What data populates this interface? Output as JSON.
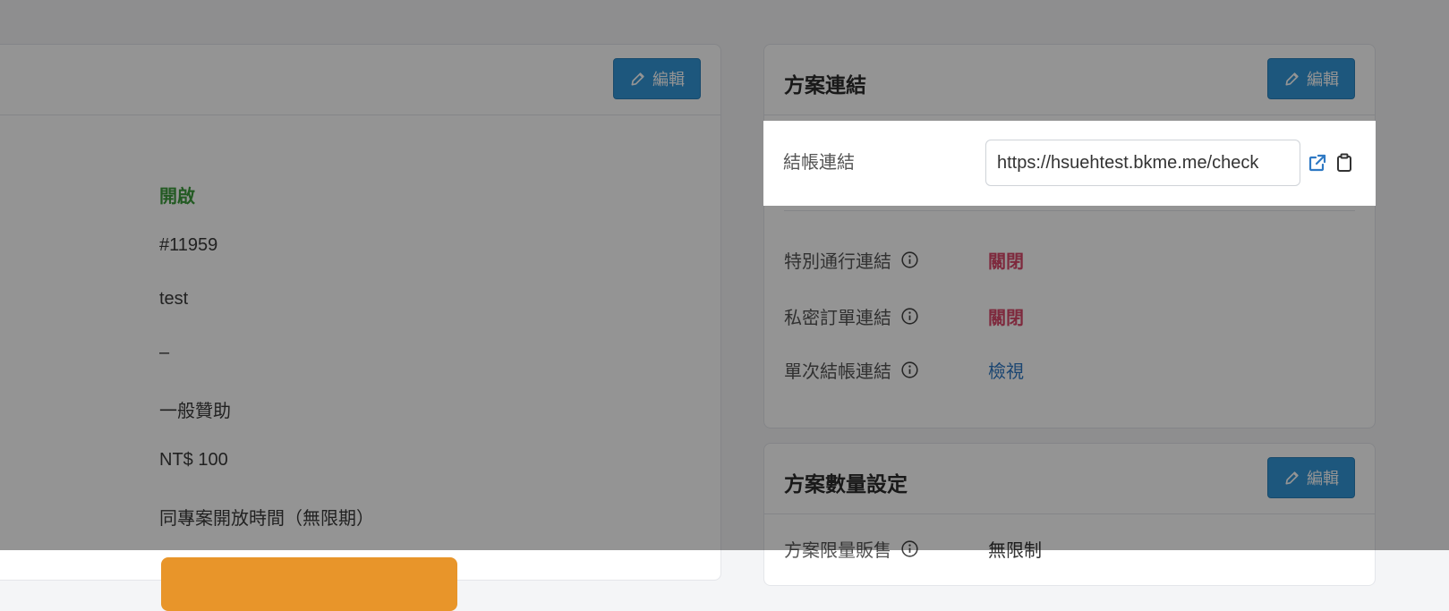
{
  "left_card": {
    "edit_label": "編輯",
    "values": {
      "status": "開啟",
      "id": "#11959",
      "name": "test",
      "dash": "–",
      "type": "一般贊助",
      "price": "NT$ 100",
      "period": "同專案開放時間（無限期）"
    }
  },
  "link_card": {
    "title": "方案連結",
    "edit_label": "編輯",
    "checkout": {
      "label": "結帳連結",
      "url": "https://hsuehtest.bkme.me/check"
    },
    "special": {
      "label": "特別通行連結",
      "value": "關閉"
    },
    "private": {
      "label": "私密訂單連結",
      "value": "關閉"
    },
    "single": {
      "label": "單次結帳連結",
      "value": "檢視"
    }
  },
  "qty_card": {
    "title": "方案數量設定",
    "edit_label": "編輯",
    "limit": {
      "label": "方案限量販售",
      "value": "無限制"
    }
  },
  "colors": {
    "accent": "#3296d8",
    "enabled": "#3c9b3c",
    "disabled": "#d9486a",
    "link": "#2f79c4"
  }
}
